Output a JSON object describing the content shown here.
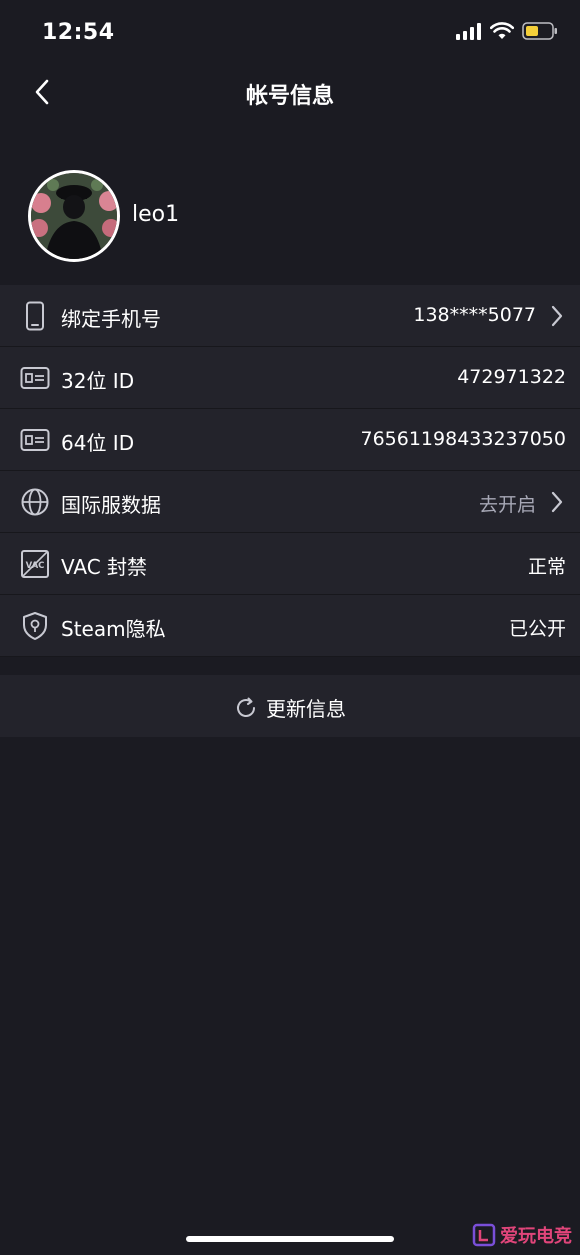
{
  "status_bar": {
    "time": "12:54",
    "battery_color": "#f4cf3a"
  },
  "nav": {
    "title": "帐号信息",
    "back_icon": "chevron-left-icon"
  },
  "profile": {
    "username": "leo1"
  },
  "rows": [
    {
      "icon": "phone-icon",
      "label": "绑定手机号",
      "value": "138****5077",
      "chevron": true
    },
    {
      "icon": "id-card-icon",
      "label": "32位 ID",
      "value": "472971322",
      "chevron": false
    },
    {
      "icon": "id-card-icon",
      "label": "64位 ID",
      "value": "76561198433237050",
      "chevron": false
    },
    {
      "icon": "globe-icon",
      "label": "国际服数据",
      "value": "去开启",
      "chevron": true
    },
    {
      "icon": "vac-icon",
      "label": "VAC 封禁",
      "value": "正常",
      "chevron": false
    },
    {
      "icon": "shield-icon",
      "label": "Steam隐私",
      "value": "已公开",
      "chevron": false
    }
  ],
  "update": {
    "label": "更新信息",
    "icon": "refresh-icon"
  },
  "watermark": {
    "text": "爱玩电竞"
  },
  "colors": {
    "background": "#1b1b22",
    "row_background": "#23232b",
    "muted_text": "#a7a8b6"
  }
}
